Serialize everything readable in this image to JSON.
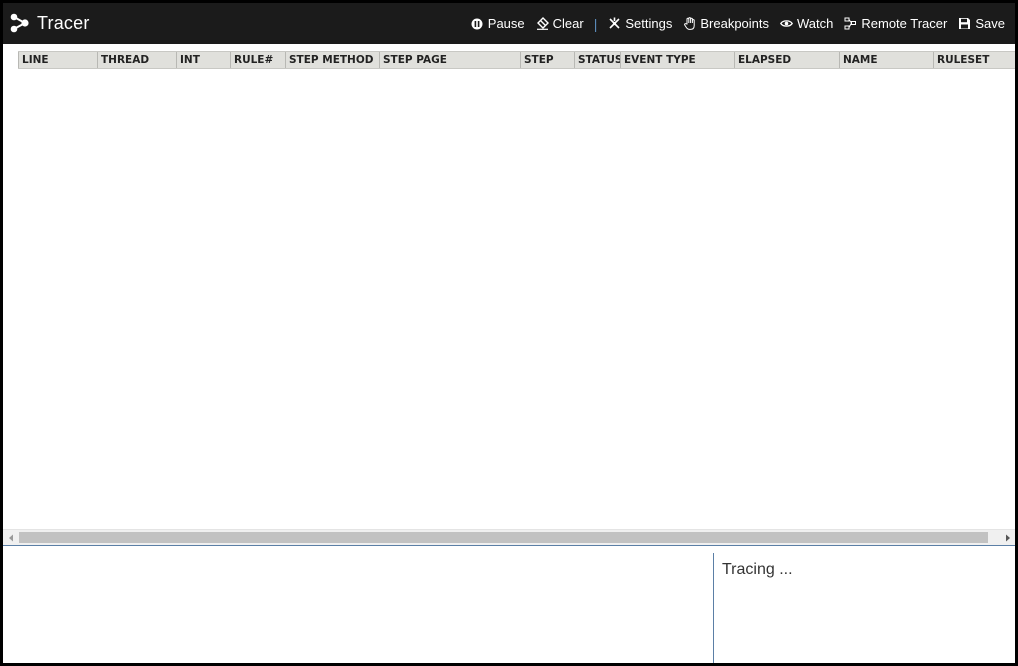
{
  "header": {
    "title": "Tracer",
    "toolbar": [
      {
        "label": "Pause",
        "icon": "pause-icon"
      },
      {
        "label": "Clear",
        "icon": "eraser-icon"
      },
      {
        "label": "Settings",
        "icon": "settings-icon"
      },
      {
        "label": "Breakpoints",
        "icon": "hand-icon"
      },
      {
        "label": "Watch",
        "icon": "eye-icon"
      },
      {
        "label": "Remote Tracer",
        "icon": "remote-icon"
      },
      {
        "label": "Save",
        "icon": "floppy-icon"
      }
    ],
    "separator": "|"
  },
  "grid": {
    "columns": [
      "LINE",
      "THREAD",
      "INT",
      "RULE#",
      "STEP METHOD",
      "STEP PAGE",
      "STEP",
      "STATUS",
      "EVENT TYPE",
      "ELAPSED",
      "NAME",
      "RULESET"
    ],
    "rows": []
  },
  "status": {
    "text": "Tracing ..."
  },
  "colors": {
    "header_bg": "#1b1b1b",
    "accent": "#5b7fa6",
    "grid_header_bg": "#e0e0dc"
  }
}
